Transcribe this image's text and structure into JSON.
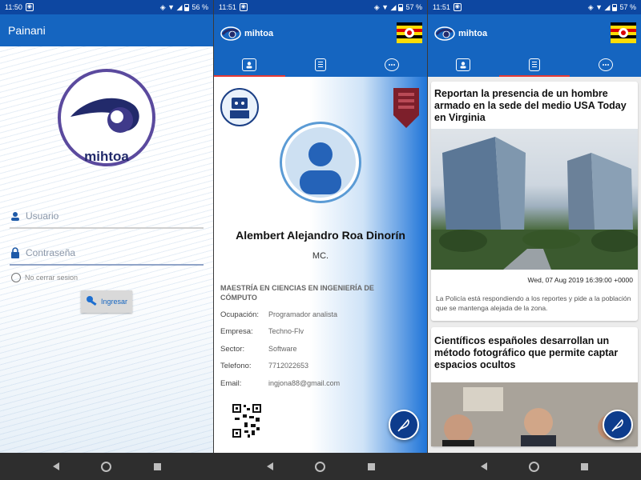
{
  "screen1": {
    "status": {
      "time": "11:50",
      "battery": "56 %"
    },
    "appbar_title": "Painani",
    "logo_text": "mihtoa",
    "username_placeholder": "Usuario",
    "password_placeholder": "Contraseña",
    "remember_label": "No cerrar sesion",
    "login_button": "Ingresar"
  },
  "screen2": {
    "status": {
      "time": "11:51",
      "battery": "57 %"
    },
    "brand": "mihtoa",
    "profile": {
      "name": "Alembert Alejandro Roa Dinorín",
      "title": "MC.",
      "degree": "MAESTRÍA EN CIENCIAS EN INGENIERÍA DE CÓMPUTO",
      "rows": [
        {
          "label": "Ocupación:",
          "value": "Programador analista"
        },
        {
          "label": "Empresa:",
          "value": "Techno-Flv"
        },
        {
          "label": "Sector:",
          "value": "Software"
        },
        {
          "label": "Telefono:",
          "value": "7712022653"
        },
        {
          "label": "Email:",
          "value": "ingjona88@gmail.com"
        }
      ]
    }
  },
  "screen3": {
    "status": {
      "time": "11:51",
      "battery": "57 %"
    },
    "brand": "mihtoa",
    "news": [
      {
        "title": "Reportan la presencia de un hombre armado en la sede del medio USA Today en Virginia",
        "date": "Wed, 07 Aug 2019 16:39:00 +0000",
        "description": "La Policía está respondiendo a los reportes y pide a la población que se mantenga alejada de la zona."
      },
      {
        "title": "Científicos españoles desarrollan un método fotográfico que permite captar espacios ocultos"
      }
    ]
  },
  "colors": {
    "primary": "#1565c0",
    "dark_primary": "#0d47a1",
    "tab_indicator": "#e53935",
    "logo_purple": "#5b4a9e"
  },
  "icons": [
    "user-icon",
    "lock-icon",
    "key-icon",
    "profile-tab-icon",
    "news-tab-icon",
    "chat-tab-icon",
    "feather-icon"
  ]
}
